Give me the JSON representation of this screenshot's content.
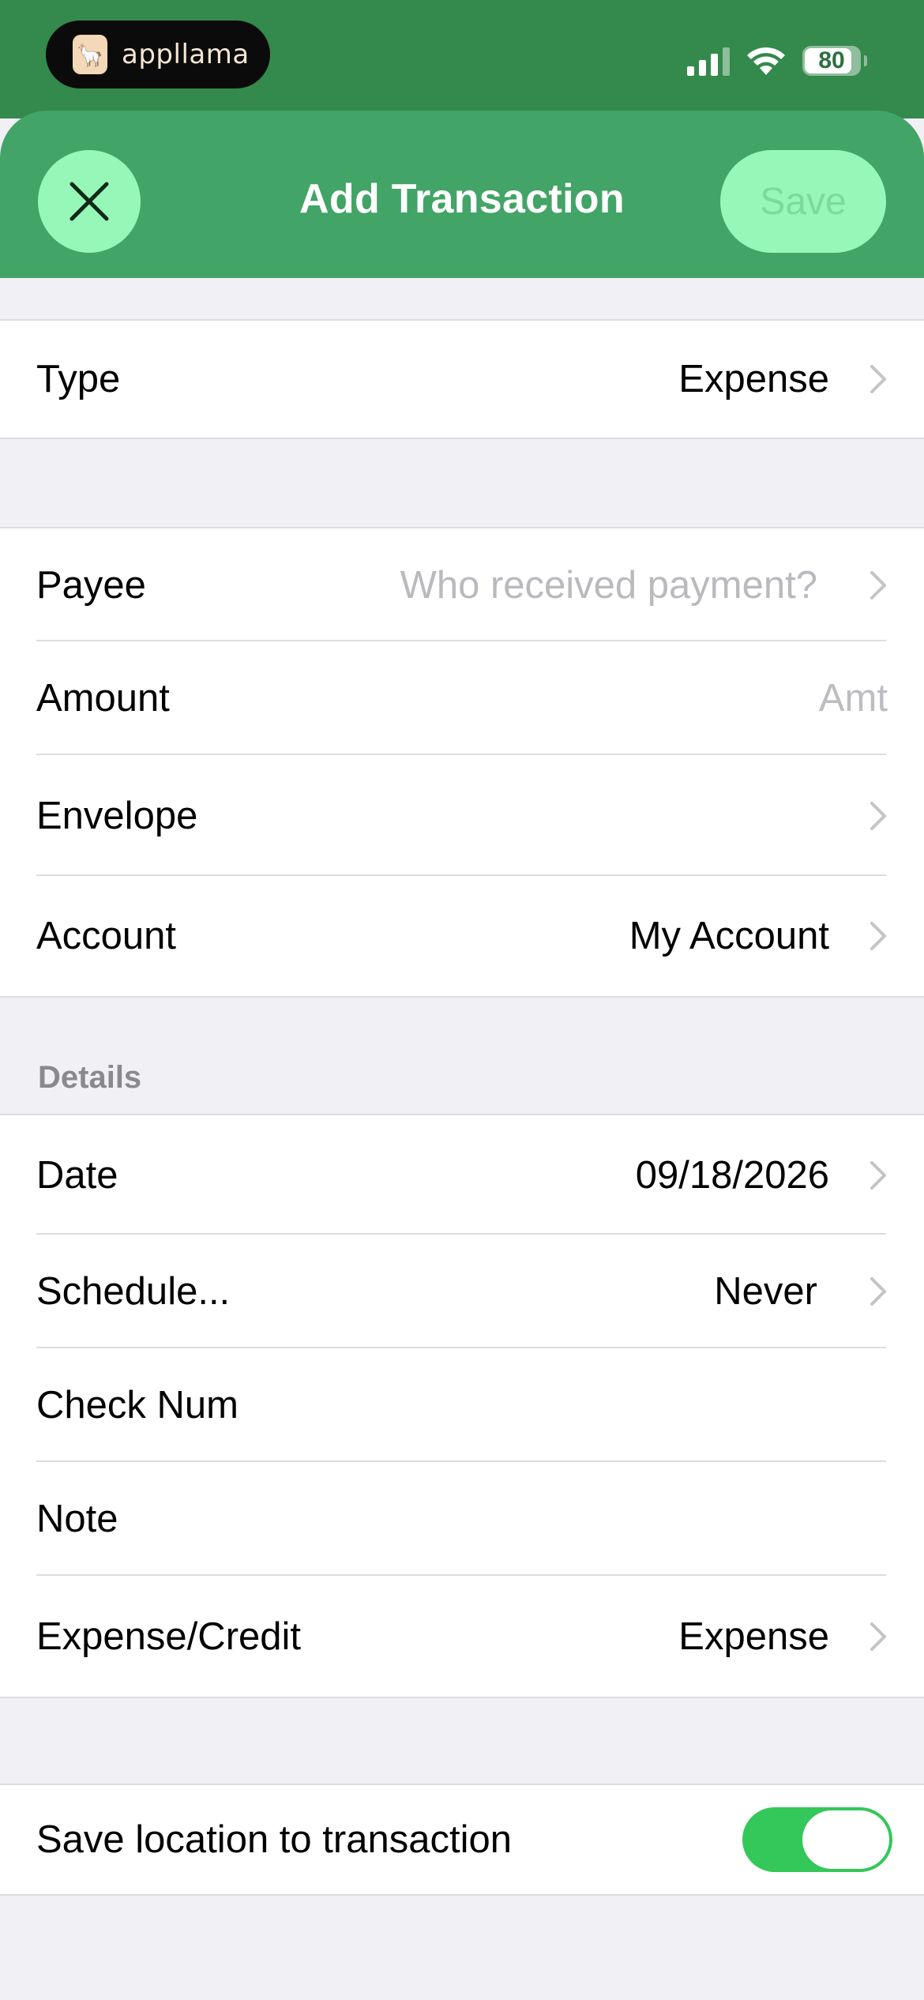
{
  "status_bar": {
    "app_pill_label": "appllama",
    "battery_level": "80"
  },
  "nav": {
    "title": "Add Transaction",
    "save_label": "Save"
  },
  "type_row": {
    "label": "Type",
    "value": "Expense"
  },
  "main_rows": {
    "payee": {
      "label": "Payee",
      "placeholder": "Who received payment?"
    },
    "amount": {
      "label": "Amount",
      "placeholder": "Amt"
    },
    "envelope": {
      "label": "Envelope",
      "value": ""
    },
    "account": {
      "label": "Account",
      "value": "My Account"
    }
  },
  "details": {
    "header": "Details",
    "date": {
      "label": "Date",
      "value": "09/18/2026"
    },
    "schedule": {
      "label": "Schedule...",
      "value": "Never"
    },
    "check_num": {
      "label": "Check Num"
    },
    "note": {
      "label": "Note"
    },
    "expense_credit": {
      "label": "Expense/Credit",
      "value": "Expense"
    }
  },
  "location": {
    "label": "Save location to transaction",
    "toggle_on": true
  },
  "colors": {
    "nav_green": "#42a466",
    "status_green": "#34894c",
    "button_mint": "#96f7b8",
    "toggle_green": "#34c759"
  }
}
